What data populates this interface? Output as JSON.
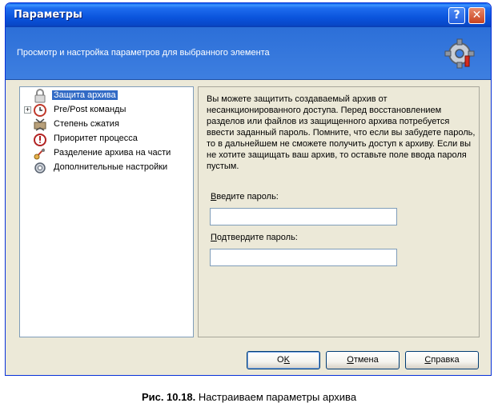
{
  "window": {
    "title": "Параметры",
    "help_glyph": "?",
    "close_glyph": "✕"
  },
  "header": {
    "text": "Просмотр и настройка параметров для выбранного элемента",
    "icon": "gear-icon"
  },
  "tree": {
    "items": [
      {
        "label": "Защита архива",
        "icon": "lock-icon",
        "selected": true,
        "expandable": false
      },
      {
        "label": "Pre/Post команды",
        "icon": "clock-icon",
        "selected": false,
        "expandable": true,
        "expander": "+"
      },
      {
        "label": "Степень сжатия",
        "icon": "compress-icon",
        "selected": false,
        "expandable": false
      },
      {
        "label": "Приоритет процесса",
        "icon": "alarm-clock-icon",
        "selected": false,
        "expandable": false
      },
      {
        "label": "Разделение архива на части",
        "icon": "split-icon",
        "selected": false,
        "expandable": false
      },
      {
        "label": "Дополнительные настройки",
        "icon": "settings-icon",
        "selected": false,
        "expandable": false
      }
    ]
  },
  "panel": {
    "description": "Вы можете защитить создаваемый архив от несанкционированного доступа. Перед восстановлением разделов или файлов из защищенного архива потребуется ввести заданный пароль. Помните, что если вы забудете пароль, то в дальнейшем не сможете получить доступ к архиву. Если вы не хотите защищать ваш архив, то оставьте поле ввода пароля пустым.",
    "password_label_key": "В",
    "password_label_rest": "ведите пароль:",
    "password_value": "",
    "confirm_label_key": "П",
    "confirm_label_rest": "одтвердите пароль:",
    "confirm_value": ""
  },
  "buttons": {
    "ok_key": "",
    "ok_label_a": "O",
    "ok_label_u": "K",
    "cancel_key": "О",
    "cancel_rest": "тмена",
    "help_key": "С",
    "help_rest": "правка"
  },
  "caption": {
    "bold": "Рис. 10.18.",
    "text": " Настраиваем параметры архива"
  }
}
